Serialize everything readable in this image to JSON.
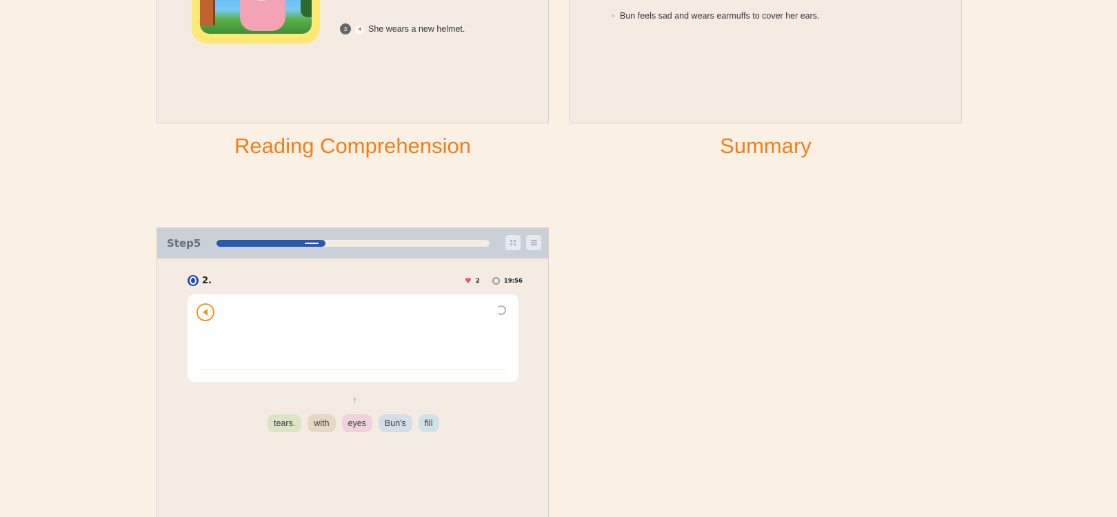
{
  "reading_comprehension": {
    "title": "Reading Comprehension",
    "item": {
      "number": "3",
      "text": "She wears a new helmet."
    }
  },
  "summary": {
    "title": "Summary",
    "item_text": "Bun feels sad and wears earmuffs to cover her ears."
  },
  "step": {
    "label": "Step5",
    "progress": 0.4,
    "question_number": "2.",
    "hearts": "2",
    "timer": "19:56",
    "word_chips": [
      {
        "text": "tears.",
        "color": "#dde4c5"
      },
      {
        "text": "with",
        "color": "#e7d8c4"
      },
      {
        "text": "eyes",
        "color": "#f0d1dc"
      },
      {
        "text": "Bun's",
        "color": "#d5dde8"
      },
      {
        "text": "fill",
        "color": "#d0e1ea"
      }
    ]
  },
  "colors": {
    "accent": "#f07e1c",
    "progress": "#2a5ab0",
    "background": "#faf0e4"
  },
  "icons": {
    "speaker": "speaker-icon",
    "grid": "grid-icon",
    "list": "list-icon",
    "heart": "heart-icon",
    "timer": "timer-icon",
    "reset": "refresh-icon",
    "arrow": "arrow-up-icon"
  }
}
